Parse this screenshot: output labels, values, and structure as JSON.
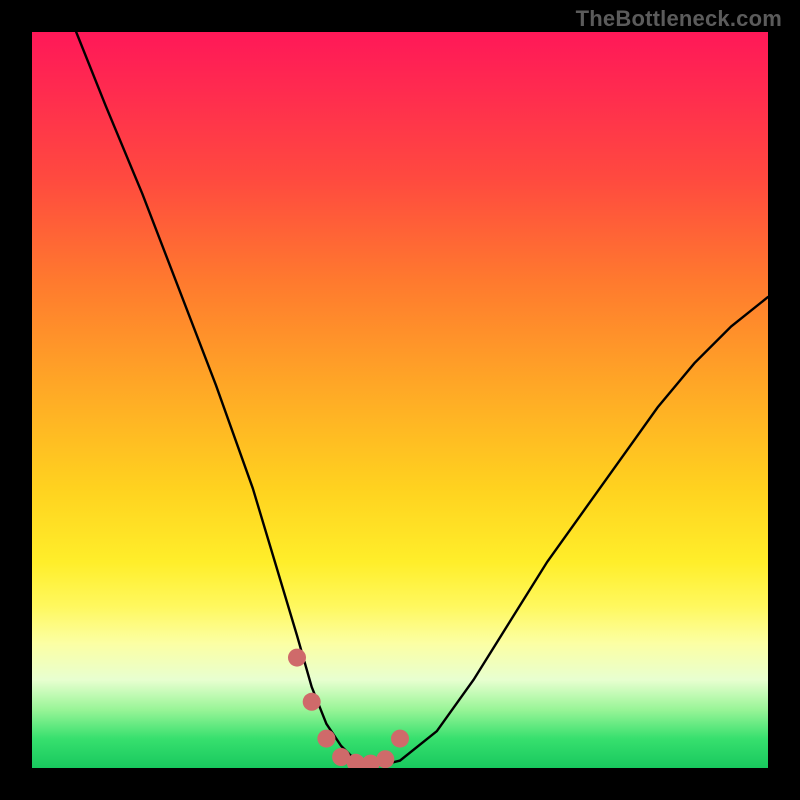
{
  "watermark": "TheBottleneck.com",
  "chart_data": {
    "type": "line",
    "title": "",
    "xlabel": "",
    "ylabel": "",
    "xlim": [
      0,
      100
    ],
    "ylim": [
      0,
      100
    ],
    "grid": false,
    "legend": false,
    "series": [
      {
        "name": "curve",
        "x": [
          6,
          10,
          15,
          20,
          25,
          30,
          33,
          36,
          38,
          40,
          42,
          44,
          46,
          48,
          50,
          55,
          60,
          65,
          70,
          75,
          80,
          85,
          90,
          95,
          100
        ],
        "values": [
          100,
          90,
          78,
          65,
          52,
          38,
          28,
          18,
          11,
          6,
          3,
          1,
          0.5,
          0.5,
          1,
          5,
          12,
          20,
          28,
          35,
          42,
          49,
          55,
          60,
          64
        ]
      }
    ],
    "markers": {
      "name": "highlight-points",
      "color": "#cf6a6a",
      "x": [
        36,
        38,
        40,
        42,
        44,
        46,
        48,
        50
      ],
      "values": [
        15,
        9,
        4,
        1.5,
        0.7,
        0.6,
        1.2,
        4
      ]
    },
    "background_gradient": {
      "top_color": "#ff1858",
      "bottom_color": "#18c85e",
      "meaning": "red-high to green-low"
    }
  }
}
